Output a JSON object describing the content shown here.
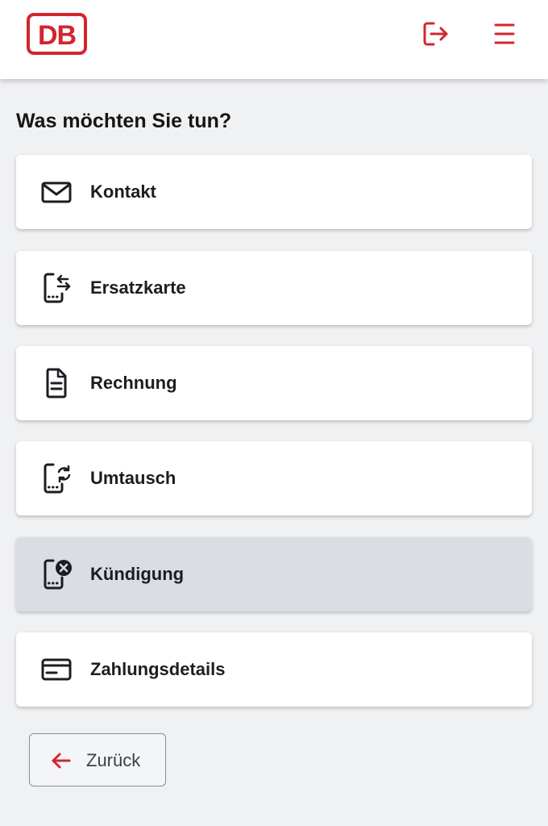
{
  "header": {
    "logo_text": "DB",
    "logout_icon": "logout-icon",
    "menu_icon": "hamburger-menu-icon"
  },
  "page": {
    "title": "Was möchten Sie tun?"
  },
  "options": [
    {
      "label": "Kontakt",
      "icon": "envelope-icon",
      "selected": false
    },
    {
      "label": "Ersatzkarte",
      "icon": "card-replace-icon",
      "selected": false
    },
    {
      "label": "Rechnung",
      "icon": "document-icon",
      "selected": false
    },
    {
      "label": "Umtausch",
      "icon": "card-exchange-icon",
      "selected": false
    },
    {
      "label": "Kündigung",
      "icon": "card-cancel-icon",
      "selected": true
    },
    {
      "label": "Zahlungsdetails",
      "icon": "credit-card-icon",
      "selected": false
    }
  ],
  "back_button": {
    "label": "Zurück",
    "icon": "arrow-left-icon"
  },
  "colors": {
    "brand_red": "#d2262c",
    "background": "#f0f1f3",
    "card": "#ffffff",
    "card_selected": "#dadde2",
    "text": "#1b1d22"
  }
}
